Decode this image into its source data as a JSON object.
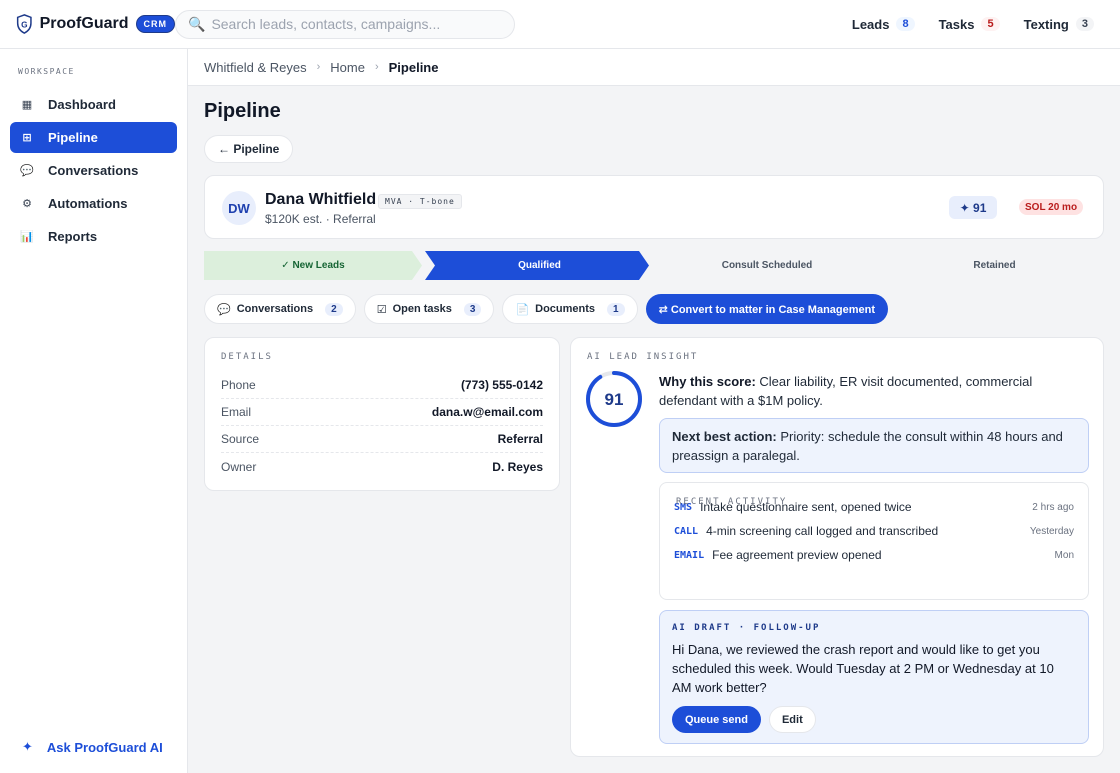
{
  "brand": {
    "name": "ProofGuard",
    "badge": "CRM",
    "icon": "shield-g-icon"
  },
  "search": {
    "placeholder": "Search leads, contacts, campaigns..."
  },
  "top_counters": [
    {
      "label": "Leads",
      "count": "8"
    },
    {
      "label": "Tasks",
      "count": "5"
    },
    {
      "label": "Texting",
      "count": "3"
    }
  ],
  "sidebar": {
    "section": "WORKSPACE",
    "items": [
      {
        "label": "Dashboard",
        "icon": "dashboard-icon",
        "active": false
      },
      {
        "label": "Pipeline",
        "icon": "pipeline-icon",
        "active": true
      },
      {
        "label": "Conversations",
        "icon": "chat-bubble-icon",
        "active": false
      },
      {
        "label": "Automations",
        "icon": "gear-icon",
        "active": false
      },
      {
        "label": "Reports",
        "icon": "bar-chart-icon",
        "active": false
      }
    ],
    "ask_ai": "Ask ProofGuard AI"
  },
  "breadcrumb": [
    "Whitfield & Reyes",
    "Home",
    "Pipeline"
  ],
  "page": {
    "title": "Pipeline",
    "back_label": "← Pipeline"
  },
  "lead": {
    "initials": "DW",
    "name": "Dana Whitfield",
    "tag": "MVA · T-bone",
    "sub": "$120K est. · Referral",
    "score": "91",
    "score_label": "✦ 91",
    "sol": "SOL 20 mo"
  },
  "stages": [
    {
      "label": "✓ New Leads",
      "state": "done"
    },
    {
      "label": "Qualified",
      "state": "current"
    },
    {
      "label": "Consult Scheduled",
      "state": "todo"
    },
    {
      "label": "Retained",
      "state": "todo"
    }
  ],
  "tabs": [
    {
      "label": "Conversations",
      "icon": "💬",
      "count": "2"
    },
    {
      "label": "Open tasks",
      "icon": "☑",
      "count": "3"
    },
    {
      "label": "Documents",
      "icon": "📄",
      "count": "1"
    }
  ],
  "convert_label": "⇄ Convert to matter in Case Management",
  "details": {
    "label": "DETAILS",
    "rows": [
      {
        "k": "Phone",
        "v": "(773) 555-0142"
      },
      {
        "k": "Email",
        "v": "dana.w@email.com"
      },
      {
        "k": "Source",
        "v": "Referral"
      },
      {
        "k": "Owner",
        "v": "D. Reyes"
      }
    ]
  },
  "insight": {
    "label": "AI LEAD INSIGHT",
    "score": "91",
    "score_fraction": 0.91,
    "why_label": "Why this score:",
    "why_text": " Clear liability, ER visit documented, commercial defendant with a $1M policy.",
    "nba_label": "Next best action:",
    "nba_text": " Priority: schedule the consult within 48 hours and preassign a paralegal.",
    "recent_label": "RECENT ACTIVITY",
    "activity": [
      {
        "kind": "SMS",
        "text": "Intake questionnaire sent, opened twice",
        "when": "2 hrs ago"
      },
      {
        "kind": "CALL",
        "text": "4-min screening call logged and transcribed",
        "when": "Yesterday"
      },
      {
        "kind": "EMAIL",
        "text": "Fee agreement preview opened",
        "when": "Mon"
      }
    ],
    "draft_label": "AI DRAFT · FOLLOW-UP",
    "draft_text": "Hi Dana, we reviewed the crash report and would like to get you scheduled this week. Would Tuesday at 2 PM or Wednesday at 10 AM work better?",
    "queue_label": "Queue send",
    "edit_label": "Edit"
  },
  "colors": {
    "accent": "#1d4ed8",
    "done": "#dcefdc",
    "todo": "#f3f4f6",
    "sol": "#b91c1c"
  }
}
